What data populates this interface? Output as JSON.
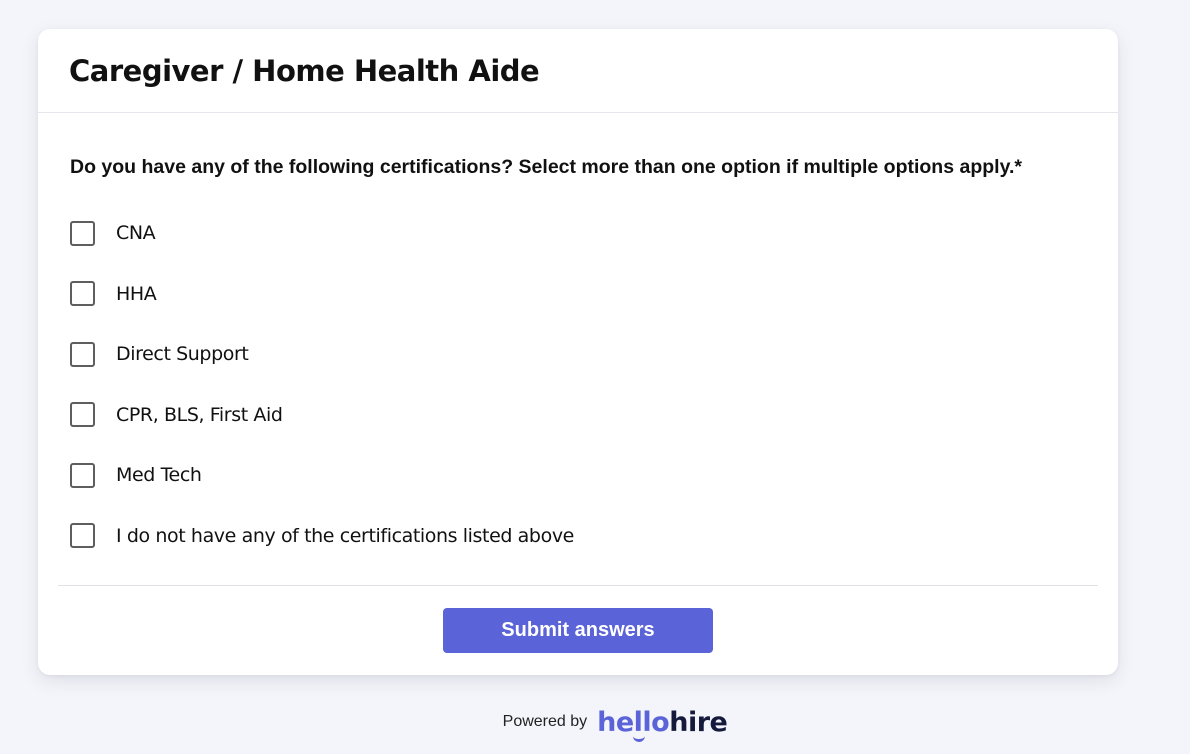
{
  "card": {
    "title": "Caregiver / Home Health Aide"
  },
  "question": {
    "text": "Do you have any of the following certifications? Select more than one option if multiple options apply.*",
    "options": [
      {
        "label": "CNA",
        "checked": false
      },
      {
        "label": "HHA",
        "checked": false
      },
      {
        "label": "Direct Support",
        "checked": false
      },
      {
        "label": "CPR, BLS, First Aid",
        "checked": false
      },
      {
        "label": "Med Tech",
        "checked": false
      },
      {
        "label": "I do not have any of the certifications listed above",
        "checked": false
      }
    ]
  },
  "actions": {
    "submit_label": "Submit answers"
  },
  "footer": {
    "powered_by": "Powered by",
    "brand_part1": "hello",
    "brand_part2": "hire"
  },
  "colors": {
    "accent": "#5a63d8",
    "brand_dark": "#151a3d",
    "page_background": "#f4f5fa"
  }
}
